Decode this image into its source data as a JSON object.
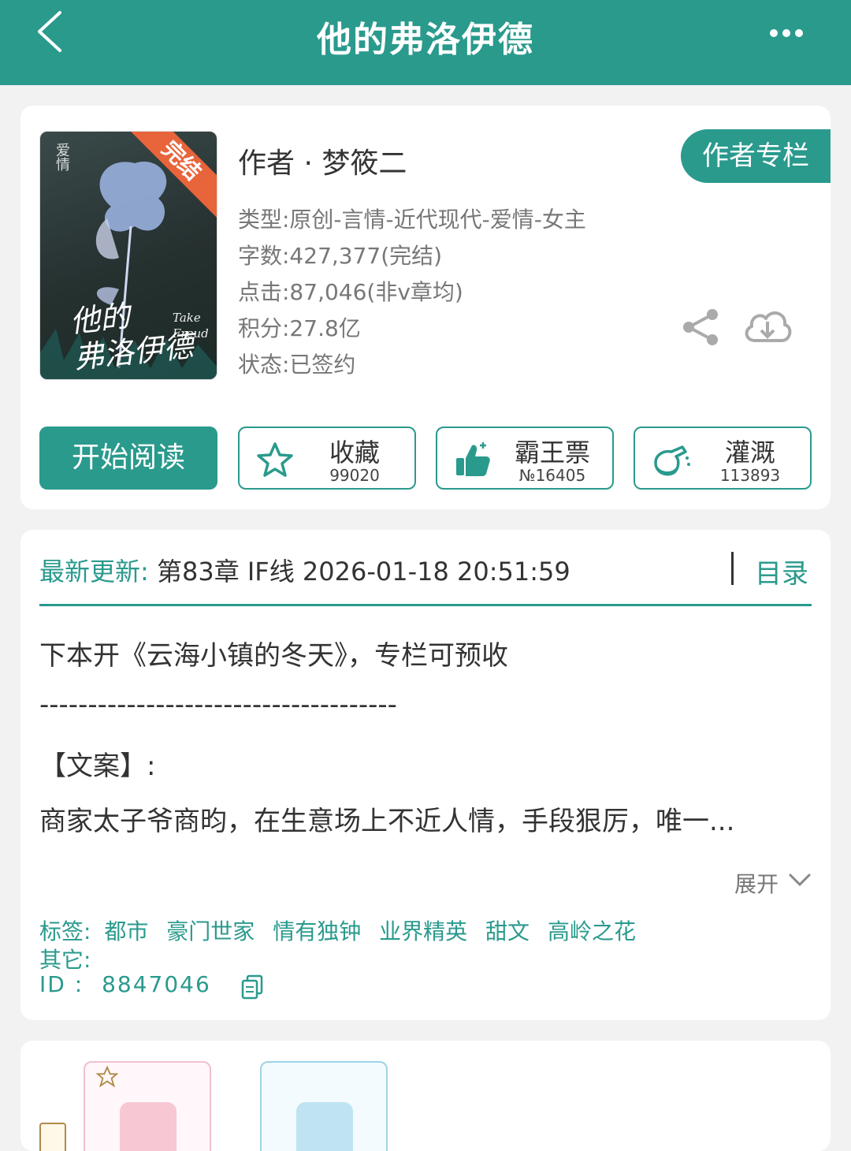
{
  "header": {
    "title": "他的弗洛伊德",
    "back_icon": "chevron-left-icon",
    "more_icon": "more-dots-icon"
  },
  "book": {
    "cover": {
      "badge": "完结",
      "title_lines": [
        "他的",
        "弗洛伊德"
      ],
      "subtitle_lines": [
        "Take",
        "Freud"
      ],
      "vertical_text": "爱情"
    },
    "author": "作者 · 梦筱二",
    "author_column_button": "作者专栏",
    "meta": [
      "类型:原创-言情-近代现代-爱情-女主",
      "字数:427,377(完结)",
      "点击:87,046(非v章均)",
      "积分:27.8亿",
      "状态:已签约"
    ]
  },
  "actions": {
    "start_reading": "开始阅读",
    "favorite": {
      "label": "收藏",
      "value": "99020"
    },
    "vote": {
      "label": "霸王票",
      "value": "№16405"
    },
    "water": {
      "label": "灌溉",
      "value": "113893"
    }
  },
  "update": {
    "label": "最新更新:",
    "value": "第83章 IF线 2026-01-18 20:51:59",
    "toc": "目录"
  },
  "intro": {
    "line1": "下本开《云海小镇的冬天》，专栏可预收",
    "line2": "-------------------------------------",
    "line3": "【文案】:",
    "line4": "商家太子爷商昀，在生意场上不近人情，手段狠厉，唯一...",
    "expand": "展开"
  },
  "tags": {
    "label": "标签:",
    "items": [
      "都市",
      "豪门世家",
      "情有独钟",
      "业界精英",
      "甜文",
      "高岭之花"
    ],
    "other_label": "其它:",
    "id_label": "ID  :",
    "id_value": "8847046"
  },
  "colors": {
    "accent": "#2a9a8d",
    "badge": "#e8643a",
    "background": "#f2f2f2"
  }
}
